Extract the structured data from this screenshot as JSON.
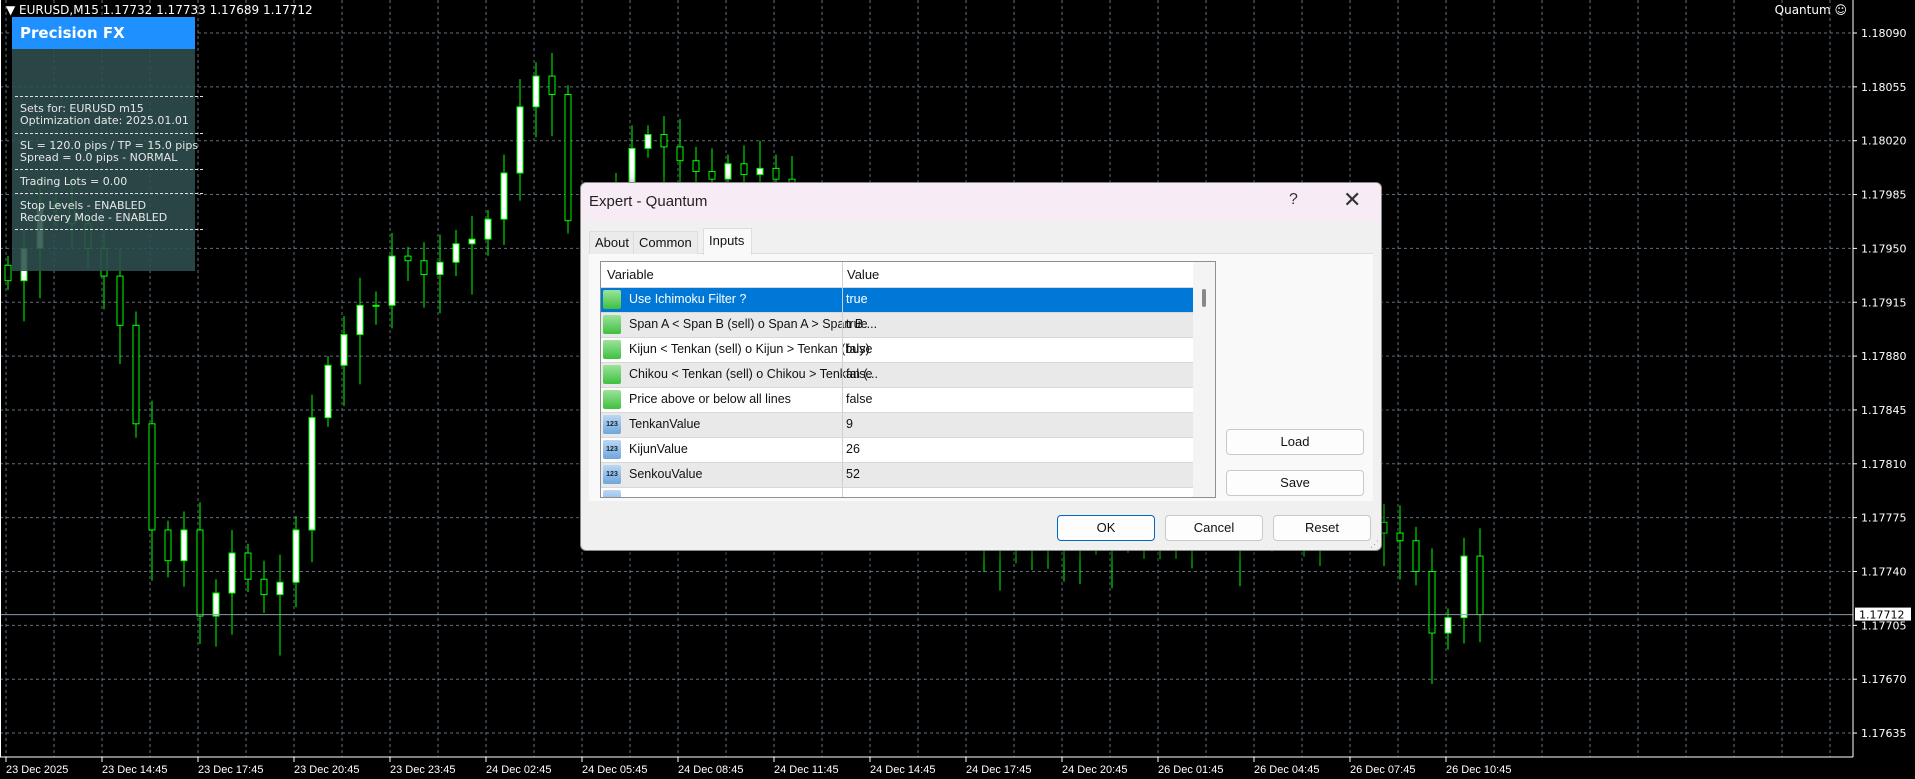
{
  "chart_header": {
    "symbol_line": "EURUSD,M15",
    "open": "1.17732",
    "high": "1.17733",
    "low": "1.17689",
    "close": "1.17712",
    "ea_name": "Quantum",
    "ea_icon": "smiley-icon"
  },
  "info_panel": {
    "title": "Precision FX",
    "lines": [
      "Sets for: EURUSD m15",
      "Optimization date: 2025.01.01",
      "SL = 120.0 pips / TP = 15.0 pips",
      "Spread = 0.0 pips - NORMAL",
      "Trading Lots = 0.00",
      "Stop Levels - ENABLED",
      "Recovery Mode - ENABLED"
    ],
    "title_color": "#1e90ff"
  },
  "dialog": {
    "title": "Expert - Quantum",
    "help": "?",
    "close": "✕",
    "tabs": [
      {
        "label": "About"
      },
      {
        "label": "Common"
      },
      {
        "label": "Inputs",
        "active": true
      }
    ],
    "columns": {
      "variable": "Variable",
      "value": "Value"
    },
    "rows": [
      {
        "icon": "bool",
        "variable": "Use Ichimoku Filter ?",
        "value": "true",
        "selected": true
      },
      {
        "icon": "bool",
        "variable": "Span A < Span B (sell) o Span A > Span B ...",
        "value": "true"
      },
      {
        "icon": "bool",
        "variable": "Kijun < Tenkan (sell) o Kijun > Tenkan (buy)",
        "value": "false"
      },
      {
        "icon": "bool",
        "variable": "Chikou < Tenkan (sell) o Chikou > Tenkan (...",
        "value": "false"
      },
      {
        "icon": "bool",
        "variable": "Price above or below all lines",
        "value": "false"
      },
      {
        "icon": "int",
        "variable": "TenkanValue",
        "value": "9"
      },
      {
        "icon": "int",
        "variable": "KijunValue",
        "value": "26"
      },
      {
        "icon": "int",
        "variable": "SenkouValue",
        "value": "52"
      }
    ],
    "int_icon_text": "123",
    "buttons": {
      "load": "Load",
      "save": "Save",
      "ok": "OK",
      "cancel": "Cancel",
      "reset": "Reset"
    }
  },
  "chart_data": {
    "type": "candlestick",
    "symbol": "EURUSD",
    "timeframe": "M15",
    "y_ticks": [
      "1.18090",
      "1.18055",
      "1.18020",
      "1.17985",
      "1.17950",
      "1.17915",
      "1.17880",
      "1.17845",
      "1.17810",
      "1.17775",
      "1.17740",
      "1.17705",
      "1.17670",
      "1.17635"
    ],
    "x_ticks": [
      "23 Dec 2025",
      "23 Dec 14:45",
      "23 Dec 17:45",
      "23 Dec 20:45",
      "23 Dec 23:45",
      "24 Dec 02:45",
      "24 Dec 05:45",
      "24 Dec 08:45",
      "24 Dec 11:45",
      "24 Dec 14:45",
      "24 Dec 17:45",
      "24 Dec 20:45",
      "26 Dec 01:45",
      "26 Dec 04:45",
      "26 Dec 07:45",
      "26 Dec 10:45"
    ],
    "ylim": [
      1.17617,
      1.1811
    ],
    "current_price": "1.17712",
    "grid": true,
    "colors": {
      "background": "#000000",
      "candle": "#00ff00",
      "bull_body": "#ffffff",
      "bear_body": "#000000",
      "grid": "#5f7080"
    },
    "approx_closes": [
      1.17929,
      1.1795,
      1.17977,
      1.17978,
      1.17966,
      1.1795,
      1.17932,
      1.179,
      1.17836,
      1.17767,
      1.17747,
      1.17767,
      1.17711,
      1.17726,
      1.17752,
      1.17735,
      1.17725,
      1.17733,
      1.17767,
      1.1784,
      1.17874,
      1.17894,
      1.17913,
      1.17913,
      1.17945,
      1.17942,
      1.17933,
      1.17941,
      1.17953,
      1.17956,
      1.17969,
      1.17999,
      1.18042,
      1.18062,
      1.1805,
      1.17968,
      1.1791,
      1.1796,
      1.1799,
      1.18015,
      1.18024,
      1.18016,
      1.18007,
      1.18,
      1.17995,
      1.18005,
      1.17998,
      1.18002,
      1.17995,
      1.1798,
      1.17965,
      1.17948,
      1.17935,
      1.17922,
      1.17905,
      1.1788,
      1.1785,
      1.17825,
      1.17805,
      1.1779,
      1.17775,
      1.17766,
      1.1776,
      1.17758,
      1.17756,
      1.17755,
      1.17757,
      1.1776,
      1.17762,
      1.17763,
      1.17765,
      1.17766,
      1.17768,
      1.17769,
      1.1777,
      1.17771,
      1.1777,
      1.17772,
      1.17774,
      1.17776,
      1.17778,
      1.17776,
      1.17779,
      1.17777,
      1.17778,
      1.17772,
      1.17765,
      1.1776,
      1.1774,
      1.177,
      1.1771,
      1.1775,
      1.17712
    ]
  }
}
